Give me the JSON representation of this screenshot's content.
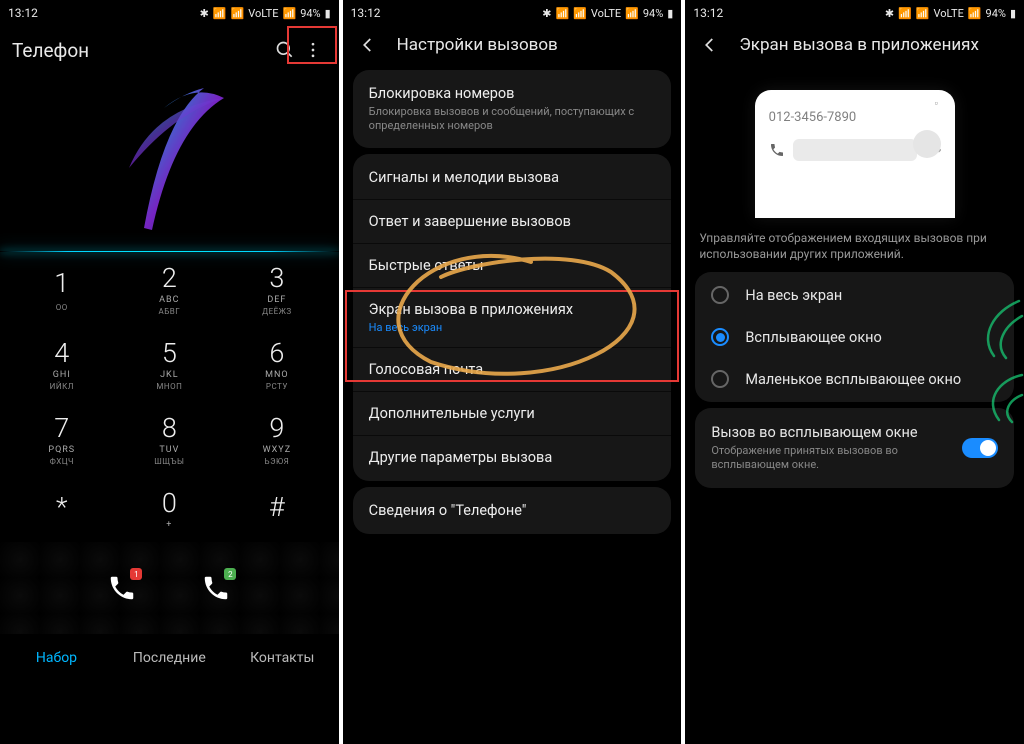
{
  "status": {
    "time": "13:12",
    "battery": "94%"
  },
  "phone1": {
    "title": "Телефон",
    "keys": [
      {
        "d": "1",
        "s1": "",
        "s2": "ОО"
      },
      {
        "d": "2",
        "s1": "ABC",
        "s2": "АБВГ"
      },
      {
        "d": "3",
        "s1": "DEF",
        "s2": "ДЕЁЖЗ"
      },
      {
        "d": "4",
        "s1": "GHI",
        "s2": "ИЙКЛ"
      },
      {
        "d": "5",
        "s1": "JKL",
        "s2": "МНОП"
      },
      {
        "d": "6",
        "s1": "MNO",
        "s2": "РСТУ"
      },
      {
        "d": "7",
        "s1": "PQRS",
        "s2": "ФХЦЧ"
      },
      {
        "d": "8",
        "s1": "TUV",
        "s2": "ШЩЪЫ"
      },
      {
        "d": "9",
        "s1": "WXYZ",
        "s2": "ЬЭЮЯ"
      },
      {
        "d": "*",
        "s1": "",
        "s2": ""
      },
      {
        "d": "0",
        "s1": "+",
        "s2": ""
      },
      {
        "d": "#",
        "s1": "",
        "s2": ""
      }
    ],
    "badge1": "1",
    "badge2": "2",
    "tabs": {
      "dial": "Набор",
      "recent": "Последние",
      "contacts": "Контакты"
    }
  },
  "phone2": {
    "title": "Настройки вызовов",
    "block": {
      "title": "Блокировка номеров",
      "sub": "Блокировка вызовов и сообщений, поступающих с определенных номеров"
    },
    "rows": {
      "signals": "Сигналы и мелодии вызова",
      "answer": "Ответ и завершение вызовов",
      "quick": "Быстрые ответы",
      "screen_title": "Экран вызова в приложениях",
      "screen_sub": "На весь экран",
      "voicemail": "Голосовая почта",
      "extra": "Дополнительные услуги",
      "other": "Другие параметры вызова",
      "about": "Сведения о \"Телефоне\""
    }
  },
  "phone3": {
    "title": "Экран вызова в приложениях",
    "preview_number": "012-3456-7890",
    "desc": "Управляйте отображением входящих вызовов при использовании других приложений.",
    "options": {
      "full": "На весь экран",
      "popup": "Всплывающее окно",
      "small": "Маленькое всплывающее окно"
    },
    "toggle": {
      "title": "Вызов во всплывающем окне",
      "sub": "Отображение принятых вызовов во всплывающем окне."
    }
  }
}
